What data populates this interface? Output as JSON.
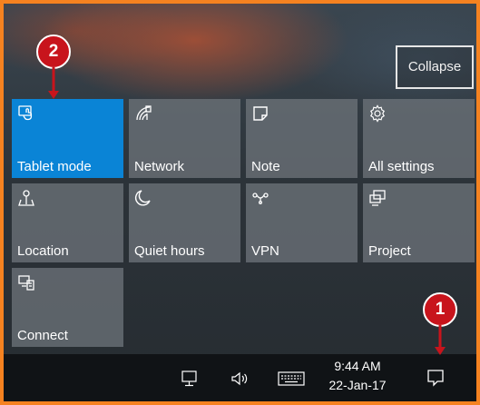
{
  "collapse_label": "Collapse",
  "tiles": [
    {
      "label": "Tablet mode",
      "icon": "tablet-mode-icon",
      "active": true
    },
    {
      "label": "Network",
      "icon": "network-icon",
      "active": false
    },
    {
      "label": "Note",
      "icon": "note-icon",
      "active": false
    },
    {
      "label": "All settings",
      "icon": "gear-icon",
      "active": false
    },
    {
      "label": "Location",
      "icon": "location-icon",
      "active": false
    },
    {
      "label": "Quiet hours",
      "icon": "moon-icon",
      "active": false
    },
    {
      "label": "VPN",
      "icon": "vpn-icon",
      "active": false
    },
    {
      "label": "Project",
      "icon": "project-icon",
      "active": false
    },
    {
      "label": "Connect",
      "icon": "connect-icon",
      "active": false
    }
  ],
  "taskbar": {
    "time": "9:44 AM",
    "date": "22-Jan-17",
    "icons": [
      "network-desktop-icon",
      "volume-icon",
      "keyboard-icon",
      "action-center-icon"
    ]
  },
  "callouts": [
    {
      "number": "1",
      "target": "action-center-button"
    },
    {
      "number": "2",
      "target": "tile-tablet-mode"
    }
  ],
  "colors": {
    "border": "#f58220",
    "active_tile": "#0a84d6",
    "callout": "#c8141c"
  }
}
